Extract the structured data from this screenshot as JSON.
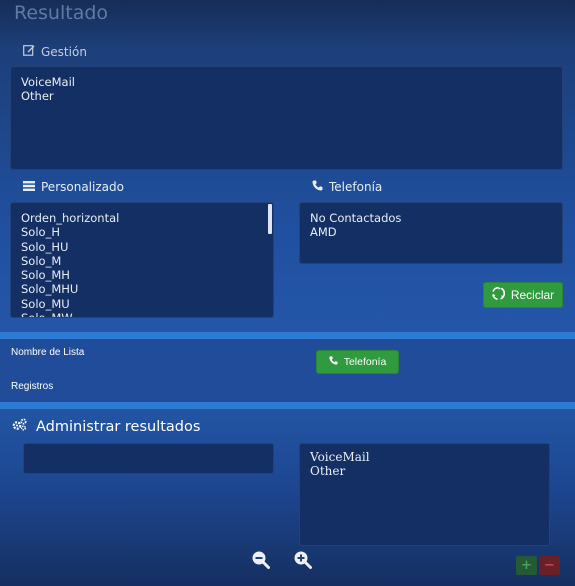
{
  "page": {
    "title": "Resultado"
  },
  "gestion": {
    "label": "Gestión",
    "items": [
      "VoiceMail",
      "Other"
    ]
  },
  "personalizado": {
    "label": "Personalizado",
    "items": [
      "Orden_horizontal",
      "Solo_H",
      "Solo_HU",
      "Solo_M",
      "Solo_MH",
      "Solo_MHU",
      "Solo_MU",
      "Solo_MW"
    ]
  },
  "telefonia": {
    "label": "Telefonía",
    "items": [
      "No Contactados",
      "AMD"
    ]
  },
  "reciclar_button": {
    "label": "Reciclar"
  },
  "lista": {
    "nombre_label": "Nombre de Lista",
    "registros_label": "Registros",
    "telefonia_button": "Telefonía"
  },
  "administrar": {
    "title": "Administrar resultados",
    "left_items": [],
    "right_items": [
      "VoiceMail",
      "Other"
    ]
  },
  "controls": {
    "zoom_out_icon": "zoom-out-icon",
    "zoom_in_icon": "zoom-in-icon",
    "add_label": "+",
    "remove_label": "−"
  },
  "colors": {
    "accent_green": "#2f9a3e",
    "separator_blue": "#2e7bd4",
    "list_bg": "#142f63"
  }
}
